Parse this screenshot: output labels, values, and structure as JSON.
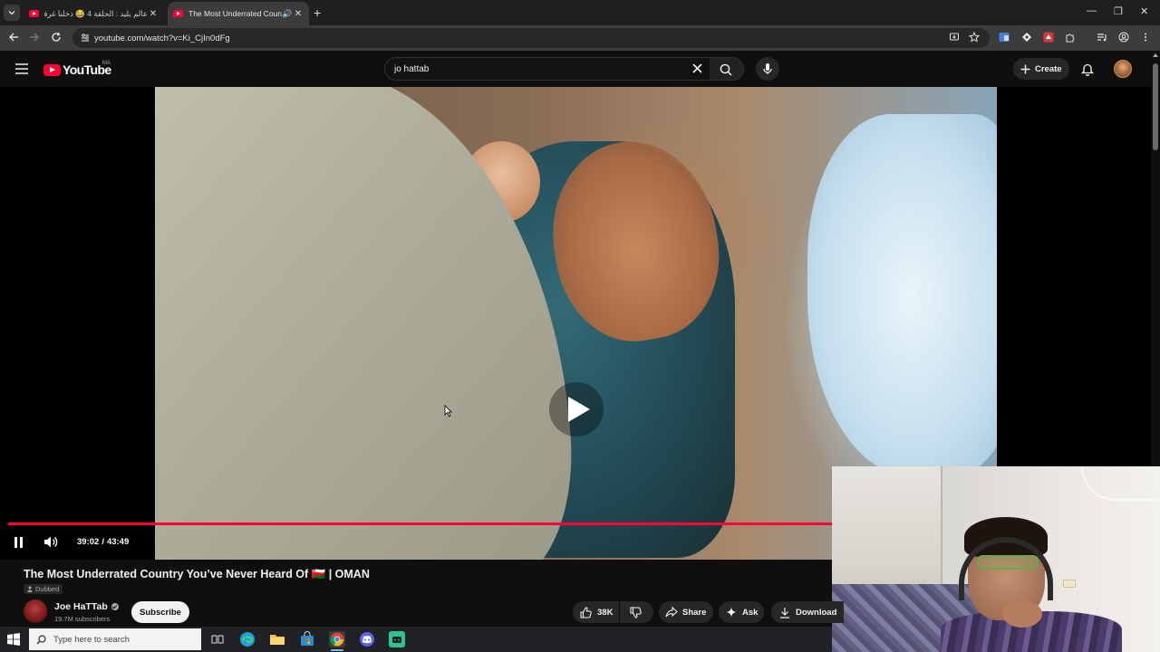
{
  "browser": {
    "tabs": [
      {
        "title": "عالم بليد : الحلقة 4 😂 دخلنا غرفة",
        "active": false
      },
      {
        "title": "The Most Underrated Country You've Never Heard Of",
        "active": true
      }
    ],
    "url": "youtube.com/watch?v=Ki_CjIn0dFg"
  },
  "youtube": {
    "logo_text": "YouTube",
    "country_code": "MA",
    "search_value": "jo hattab",
    "create_label": "Create"
  },
  "player": {
    "current_time": "39:02",
    "separator": "/",
    "duration": "43:49",
    "progress_fraction": 0.891,
    "state": "playing"
  },
  "video": {
    "title": "The Most Underrated Country You’ve Never Heard Of 🇴🇲 | OMAN",
    "dubbed_label": "Dubbed",
    "channel_name": "Joe HaTTab",
    "subscribers": "19.7M subscribers",
    "subscribe_label": "Subscribe",
    "likes": "38K",
    "share_label": "Share",
    "ask_label": "Ask",
    "download_label": "Download"
  },
  "taskbar": {
    "search_placeholder": "Type here to search",
    "apps": [
      "task-view-icon",
      "edge-icon",
      "file-explorer-icon",
      "store-icon",
      "chrome-icon",
      "discord-icon",
      "app-icon"
    ]
  },
  "colors": {
    "accent_red": "#ff0033",
    "background": "#0f0f0f"
  }
}
